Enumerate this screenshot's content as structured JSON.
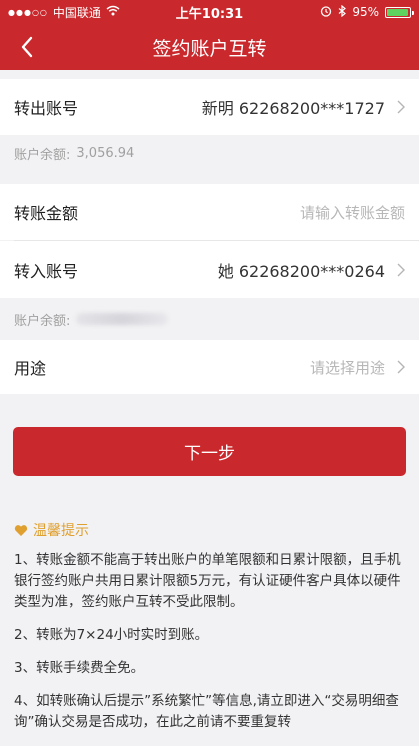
{
  "status_bar": {
    "carrier": "中国联通",
    "time": "上午10:31",
    "battery": "95%",
    "battery_level": 0.95
  },
  "nav": {
    "title": "签约账户互转"
  },
  "from_account": {
    "label": "转出账号",
    "value": "新明 62268200***1727",
    "balance_label": "账户余额:",
    "balance": "3,056.94"
  },
  "amount": {
    "label": "转账金额",
    "placeholder": "请输入转账金额"
  },
  "to_account": {
    "label": "转入账号",
    "value": "她 62268200***0264",
    "balance_label": "账户余额:"
  },
  "purpose": {
    "label": "用途",
    "placeholder": "请选择用途"
  },
  "next_button": "下一步",
  "tips": {
    "title": "温馨提示",
    "items": [
      "1、转账金额不能高于转出账户的单笔限额和日累计限额，且手机银行签约账户共用日累计限额5万元，有认证硬件客户具体以硬件类型为准，签约账户互转不受此限制。",
      "2、转账为7×24小时实时到账。",
      "3、转账手续费全免。",
      "4、如转账确认后提示”系统繁忙”等信息,请立即进入“交易明细查询”确认交易是否成功，在此之前请不要重复转"
    ]
  },
  "colors": {
    "brand_red": "#c9282c",
    "tip_heart": "#e0a030"
  }
}
